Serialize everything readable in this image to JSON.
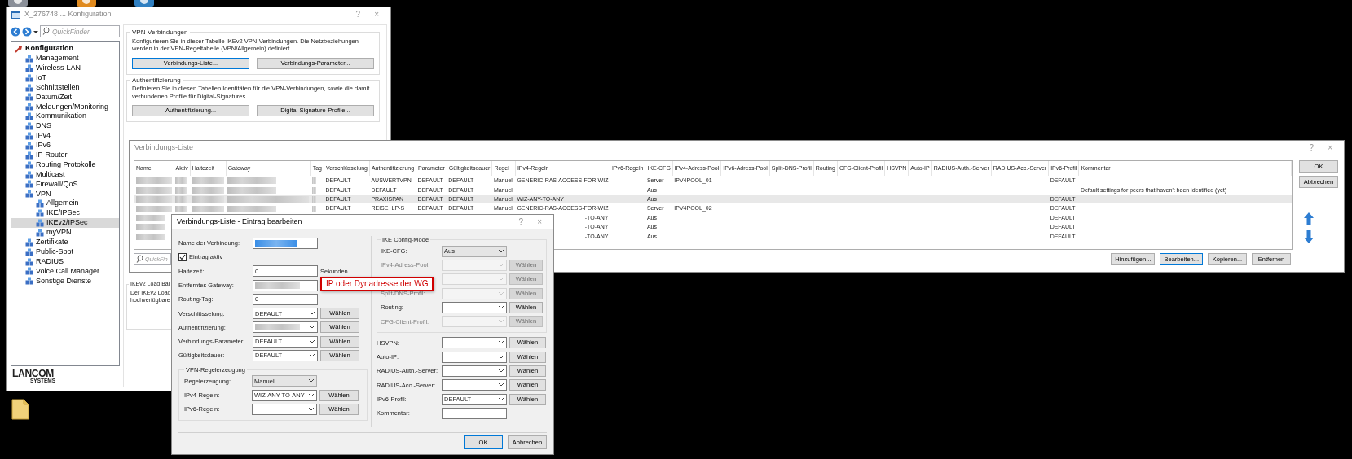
{
  "config_window": {
    "title": "X_276748 ... Konfiguration",
    "help": "?",
    "close": "×",
    "quickfinder": {
      "placeholder": "QuickFinder"
    },
    "tree": [
      {
        "label": "Konfiguration",
        "selected": false,
        "children": [
          {
            "label": "Management",
            "selected": false
          },
          {
            "label": "Wireless-LAN",
            "selected": false
          },
          {
            "label": "IoT",
            "selected": false
          },
          {
            "label": "Schnittstellen",
            "selected": false
          },
          {
            "label": "Datum/Zeit",
            "selected": false
          },
          {
            "label": "Meldungen/Monitoring",
            "selected": false
          },
          {
            "label": "Kommunikation",
            "selected": false
          },
          {
            "label": "DNS",
            "selected": false
          },
          {
            "label": "IPv4",
            "selected": false
          },
          {
            "label": "IPv6",
            "selected": false
          },
          {
            "label": "IP-Router",
            "selected": false
          },
          {
            "label": "Routing Protokolle",
            "selected": false
          },
          {
            "label": "Multicast",
            "selected": false
          },
          {
            "label": "Firewall/QoS",
            "selected": false
          },
          {
            "label": "VPN",
            "selected": false,
            "children": [
              {
                "label": "Allgemein",
                "selected": false
              },
              {
                "label": "IKE/IPSec",
                "selected": false
              },
              {
                "label": "IKEv2/IPSec",
                "selected": true
              },
              {
                "label": "myVPN",
                "selected": false
              }
            ]
          },
          {
            "label": "Zertifikate",
            "selected": false
          },
          {
            "label": "Public-Spot",
            "selected": false
          },
          {
            "label": "RADIUS",
            "selected": false
          },
          {
            "label": "Voice Call Manager",
            "selected": false
          },
          {
            "label": "Sonstige Dienste",
            "selected": false
          }
        ]
      }
    ],
    "logo": {
      "wordmark": "LANCOM",
      "subtitle": "SYSTEMS"
    },
    "groups": [
      {
        "title": "VPN-Verbindungen",
        "text": "Konfigurieren Sie in dieser Tabelle IKEv2 VPN-Verbindungen. Die Netzbeziehungen werden in der VPN-Regeltabelle (VPN/Allgemein) definiert.",
        "buttons": [
          {
            "label": "Verbindungs-Liste...",
            "focused": true
          },
          {
            "label": "Verbindungs-Parameter...",
            "focused": false
          }
        ]
      },
      {
        "title": "Authentifizierung",
        "text": "Definieren Sie in diesen Tabellen Identitäten für die VPN-Verbindungen, sowie die damit verbundenen Profile für Digital-Signatures.",
        "buttons": [
          {
            "label": "Authentifizierung...",
            "focused": false
          },
          {
            "label": "Digital-Signature-Profile...",
            "focused": false
          }
        ]
      }
    ],
    "partial_group": {
      "title": "IKEv2 Load Bal",
      "lines": [
        "Der IKEv2 Load",
        "hochverfügbare"
      ]
    }
  },
  "list_window": {
    "title": "Verbindungs-Liste",
    "help": "?",
    "close": "×",
    "columns": [
      "Name",
      "Aktiv",
      "Haltezeit",
      "Gateway",
      "Tag",
      "Verschlüsselung",
      "Authentifizierung",
      "Parameter",
      "Gültigkeitsdauer",
      "Regel",
      "IPv4-Regeln",
      "IPv6-Regeln",
      "IKE-CFG",
      "IPv4-Adress-Pool",
      "IPv6-Adress-Pool",
      "Split-DNS-Profil",
      "Routing",
      "CFG-Client-Profil",
      "HSVPN",
      "Auto-IP",
      "RADIUS-Auth.-Server",
      "RADIUS-Acc.-Server",
      "IPv6-Profil",
      "Kommentar"
    ],
    "rows": [
      {
        "kind": "full",
        "selected": false,
        "redacted": true,
        "cells": [
          null,
          null,
          null,
          null,
          null,
          "DEFAULT",
          "AUSWERTVPN",
          "DEFAULT",
          "DEFAULT",
          "Manuell",
          "GENERIC-RAS-ACCESS-FOR-WIZ",
          null,
          "Server",
          "IPV4POOL_01",
          null,
          null,
          null,
          null,
          null,
          null,
          null,
          null,
          "DEFAULT",
          null
        ]
      },
      {
        "kind": "full",
        "selected": false,
        "redacted": true,
        "cells": [
          null,
          null,
          null,
          null,
          null,
          "DEFAULT",
          "DEFAULT",
          "DEFAULT",
          "DEFAULT",
          "Manuell",
          null,
          null,
          "Aus",
          null,
          null,
          null,
          null,
          null,
          null,
          null,
          null,
          null,
          null,
          "Default settings for peers that haven't been identified (yet)"
        ]
      },
      {
        "kind": "full",
        "selected": true,
        "redacted": true,
        "cells": [
          null,
          null,
          null,
          null,
          null,
          "DEFAULT",
          "PRAXISPAN",
          "DEFAULT",
          "DEFAULT",
          "Manuell",
          "WIZ-ANY-TO-ANY",
          null,
          "Aus",
          null,
          null,
          null,
          null,
          null,
          null,
          null,
          null,
          null,
          "DEFAULT",
          null
        ]
      },
      {
        "kind": "full",
        "selected": false,
        "redacted": true,
        "cells": [
          null,
          null,
          null,
          null,
          null,
          "DEFAULT",
          "REISE+LP-S",
          "DEFAULT",
          "DEFAULT",
          "Manuell",
          "GENERIC-RAS-ACCESS-FOR-WIZ",
          null,
          "Server",
          "IPV4POOL_02",
          null,
          null,
          null,
          null,
          null,
          null,
          null,
          null,
          "DEFAULT",
          null
        ]
      },
      {
        "kind": "covered",
        "selected": false,
        "redacted": true,
        "cells": [
          null,
          null,
          null,
          null,
          null,
          null,
          null,
          null,
          null,
          null,
          "-TO-ANY",
          null,
          "Aus",
          null,
          null,
          null,
          null,
          null,
          null,
          null,
          null,
          null,
          "DEFAULT",
          null
        ]
      },
      {
        "kind": "covered",
        "selected": false,
        "redacted": true,
        "cells": [
          null,
          null,
          null,
          null,
          null,
          null,
          null,
          null,
          null,
          null,
          "-TO-ANY",
          null,
          "Aus",
          null,
          null,
          null,
          null,
          null,
          null,
          null,
          null,
          null,
          "DEFAULT",
          null
        ]
      },
      {
        "kind": "covered",
        "selected": false,
        "redacted": true,
        "cells": [
          null,
          null,
          null,
          null,
          null,
          null,
          null,
          null,
          null,
          null,
          "-TO-ANY",
          null,
          "Aus",
          null,
          null,
          null,
          null,
          null,
          null,
          null,
          null,
          null,
          "DEFAULT",
          null
        ]
      }
    ],
    "search": {
      "placeholder": "QuickFin"
    },
    "side_buttons": [
      {
        "label": "OK"
      },
      {
        "label": "Abbrechen"
      }
    ],
    "bottom_buttons": [
      {
        "label": "Hinzufügen...",
        "focused": false
      },
      {
        "label": "Bearbeiten...",
        "focused": true
      },
      {
        "label": "Kopieren...",
        "focused": false
      },
      {
        "label": "Entfernen",
        "focused": false
      }
    ]
  },
  "edit_dialog": {
    "title": "Verbindungs-Liste - Eintrag bearbeiten",
    "help": "?",
    "close": "×",
    "left_fields": [
      {
        "kind": "text",
        "label": "Name der Verbindung:",
        "redacted": true
      },
      {
        "kind": "checkbox",
        "label": "Eintrag aktiv",
        "checked": true
      },
      {
        "kind": "text",
        "label": "Haltezeit:",
        "value": "0",
        "unit": "Sekunden"
      },
      {
        "kind": "text",
        "label": "Entferntes Gateway:",
        "redacted": true,
        "callout": "IP oder Dynadresse der WG"
      },
      {
        "kind": "text",
        "label": "Routing-Tag:",
        "value": "0"
      },
      {
        "kind": "combo",
        "label": "Verschlüsselung:",
        "value": "DEFAULT",
        "button": "Wählen"
      },
      {
        "kind": "combo",
        "label": "Authentifizierung:",
        "redacted": true,
        "button": "Wählen"
      },
      {
        "kind": "combo",
        "label": "Verbindungs-Parameter:",
        "value": "DEFAULT",
        "button": "Wählen"
      },
      {
        "kind": "combo",
        "label": "Gültigkeitsdauer:",
        "value": "DEFAULT",
        "button": "Wählen"
      }
    ],
    "rule_group": {
      "title": "VPN-Regelerzeugung",
      "fields": [
        {
          "kind": "dropdown",
          "label": "Regelerzeugung:",
          "value": "Manuell"
        },
        {
          "kind": "combo",
          "label": "IPv4-Regeln:",
          "value": "WIZ-ANY-TO-ANY",
          "button": "Wählen"
        },
        {
          "kind": "combo",
          "label": "IPv6-Regeln:",
          "button": "Wählen"
        }
      ]
    },
    "ike_group": {
      "title": "IKE Config-Mode",
      "fields": [
        {
          "kind": "dropdown",
          "label": "IKE-CFG:",
          "value": "Aus",
          "disabled": false
        },
        {
          "kind": "combo",
          "label": "IPv4-Adress-Pool:",
          "button": "Wählen",
          "disabled": true
        },
        {
          "kind": "combo",
          "button": "Wählen",
          "disabled": true
        },
        {
          "kind": "combo",
          "label": "Split-DNS-Profil:",
          "button": "Wählen",
          "disabled": true
        },
        {
          "kind": "combo",
          "label": "Routing:",
          "button": "Wählen",
          "disabled": false
        },
        {
          "kind": "combo",
          "label": "CFG-Client-Profil:",
          "button": "Wählen",
          "disabled": true
        }
      ]
    },
    "right_fields": [
      {
        "kind": "combo",
        "label": "HSVPN:",
        "button": "Wählen"
      },
      {
        "kind": "combo",
        "label": "Auto-IP:",
        "button": "Wählen"
      },
      {
        "kind": "combo",
        "label": "RADIUS-Auth.-Server:",
        "button": "Wählen"
      },
      {
        "kind": "combo",
        "label": "RADIUS-Acc.-Server:",
        "button": "Wählen"
      },
      {
        "kind": "combo",
        "label": "IPv6-Profil:",
        "value": "DEFAULT",
        "button": "Wählen"
      },
      {
        "kind": "text",
        "label": "Kommentar:"
      }
    ],
    "buttons": [
      {
        "label": "OK",
        "focused": true
      },
      {
        "label": "Abbrechen",
        "focused": false
      }
    ]
  }
}
